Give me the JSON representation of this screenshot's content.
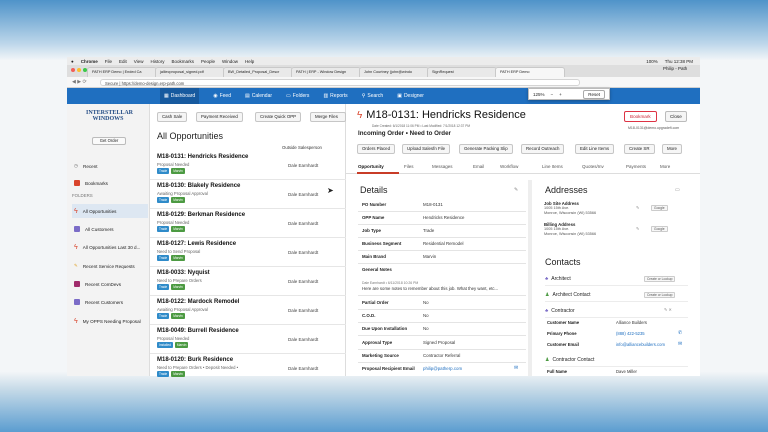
{
  "mac": {
    "app": "Chrome",
    "menus": [
      "File",
      "Edit",
      "View",
      "History",
      "Bookmarks",
      "People",
      "Window",
      "Help"
    ],
    "status": "100%",
    "clock": "Thu 12:38 PM",
    "user": "Philip - Path"
  },
  "browser": {
    "tabs": [
      "PATH ERP Demo | Ended Ca",
      "jalliecproposal_signed.pdf",
      "BW_Detailed_Proposal_Descr",
      "PATH | ERP - Window Design",
      "John Courtney (john@windo",
      "SignRequest",
      "PATH ERP Demo"
    ],
    "url": "Secure | https://demo-design.erp-path.com",
    "zoom": {
      "value": "125%",
      "minus": "−",
      "plus": "+",
      "reset": "Reset"
    }
  },
  "nav": {
    "items": [
      "Dashboard",
      "Feed",
      "Calendar",
      "Folders",
      "Reports",
      "Search",
      "Designer"
    ]
  },
  "sidebar": {
    "logo_line1": "INTERSTELLAR",
    "logo_line2": "WINDOWS",
    "get_order": "Get Order",
    "top_items": [
      "Recent",
      "Bookmarks"
    ],
    "folders_heading": "FOLDERS",
    "folders": [
      "All Opportunities",
      "All Customers",
      "All Opportunities Last 30 d...",
      "Recent Service Requests",
      "Recent ComDevs",
      "Recent Customers",
      "My OPPS Needing Proposal"
    ]
  },
  "list": {
    "toolbar": [
      "Cash Sale",
      "Payment Received",
      "Create Quick OPP",
      "Merge Files"
    ],
    "title": "All Opportunities",
    "col_header": "Outside Salesperson",
    "rows": [
      {
        "title": "M18-0131: Hendricks Residence",
        "status": "Proposal Needed",
        "badges": [
          "Trade",
          "Marvin"
        ],
        "sp": "Dale Earnhardt"
      },
      {
        "title": "M18-0130: Blakely Residence",
        "status": "Awaiting Proposal Approval",
        "badges": [
          "Trade",
          "Marvin"
        ],
        "sp": "Dale Earnhardt"
      },
      {
        "title": "M18-0129: Berkman Residence",
        "status": "Proposal Needed",
        "badges": [
          "Trade",
          "Marvin"
        ],
        "sp": "Dale Earnhardt"
      },
      {
        "title": "M18-0127: Lewis Residence",
        "status": "Need to Send Proposal",
        "badges": [
          "Trade",
          "Marvin"
        ],
        "sp": "Dale Earnhardt"
      },
      {
        "title": "M18-0033: Nyquist",
        "status": "Need to Prepare Orders",
        "badges": [
          "Trade",
          "Marvin"
        ],
        "sp": "Dale Earnhardt"
      },
      {
        "title": "M18-0122: Mardock Remodel",
        "status": "Awaiting Proposal Approval",
        "badges": [
          "Trade",
          "Marvin"
        ],
        "sp": "Dale Earnhardt"
      },
      {
        "title": "M18-0049: Burrell Residence",
        "status": "Proposal Needed",
        "badges": [
          "Installed",
          "Marvin"
        ],
        "sp": "Dale Earnhardt"
      },
      {
        "title": "M18-0120: Burk Residence",
        "status": "Need to Prepare Orders • Deposit Needed •",
        "badges": [
          "Trade",
          "Marvin"
        ],
        "sp": "Dale Earnhardt"
      }
    ]
  },
  "detail": {
    "title": "M18-0131: Hendricks Residence",
    "meta": "Date Created: 6/1/2018 11:06 PM • Last Modified: 7/1/2018 12:37 PM",
    "subtitle": "Incoming Order • Need to Order",
    "bookmark": "Bookmark",
    "close": "Close",
    "email": "M18-0131@demo.upgradefi.com",
    "actions": [
      "Orders Placed",
      "Upload Salesfn File",
      "Generate Packing Slip",
      "Record Outreach",
      "Edit Line Items",
      "Create SR",
      "More"
    ],
    "tabs": [
      "Opportunity",
      "Files",
      "Messages",
      "Email",
      "Workflow",
      "Line Items",
      "Quotes/Inv",
      "Payments",
      "More"
    ],
    "details_heading": "Details",
    "fields": [
      {
        "k": "PO Number",
        "v": "M18-0131"
      },
      {
        "k": "OPP Name",
        "v": "Hendricks Residence"
      },
      {
        "k": "Job Type",
        "v": "Trade"
      },
      {
        "k": "Business Segment",
        "v": "Residential Remodel"
      },
      {
        "k": "Main Brand",
        "v": "Marvin"
      }
    ],
    "general_notes_k": "General Notes",
    "notes_meta": "Dale Earnhardt • 6/11/2018 10:26 PM",
    "notes_text": "Here are some notes to remember about this job. What they want, etc...",
    "fields2": [
      {
        "k": "Partial Order",
        "v": "No"
      },
      {
        "k": "C.O.D.",
        "v": "No"
      },
      {
        "k": "Due Upon Installation",
        "v": "No"
      },
      {
        "k": "Approval Type",
        "v": "Signed Proposal"
      },
      {
        "k": "Marketing Source",
        "v": "Contractor Referral"
      },
      {
        "k": "Proposal Recipient Email",
        "v": "philip@patherp.com"
      }
    ],
    "addresses_heading": "Addresses",
    "job_site_k": "Job Site Address",
    "job_site_v1": "1005 15th Ave.",
    "job_site_v2": "Monroe, Wisconsin (WI) 53566",
    "billing_k": "Billing Address",
    "billing_v1": "1005 15th Ave.",
    "billing_v2": "Monroe, Wisconsin (WI) 53566",
    "google": "Google",
    "contacts_heading": "Contacts",
    "contacts": [
      "Architect",
      "Architect Contact",
      "Contractor"
    ],
    "create_lookup": "Create or Lookup",
    "customer_name_k": "Customer Name",
    "customer_name_v": "Alliance Builders",
    "primary_phone_k": "Primary Phone",
    "primary_phone_v": "(888) 422-5235",
    "customer_email_k": "Customer Email",
    "customer_email_v": "info@alliancebuilders.com",
    "contractor_contact": "Contractor Contact",
    "full_name_k": "Full Name",
    "full_name_v": "Dave Miller"
  }
}
